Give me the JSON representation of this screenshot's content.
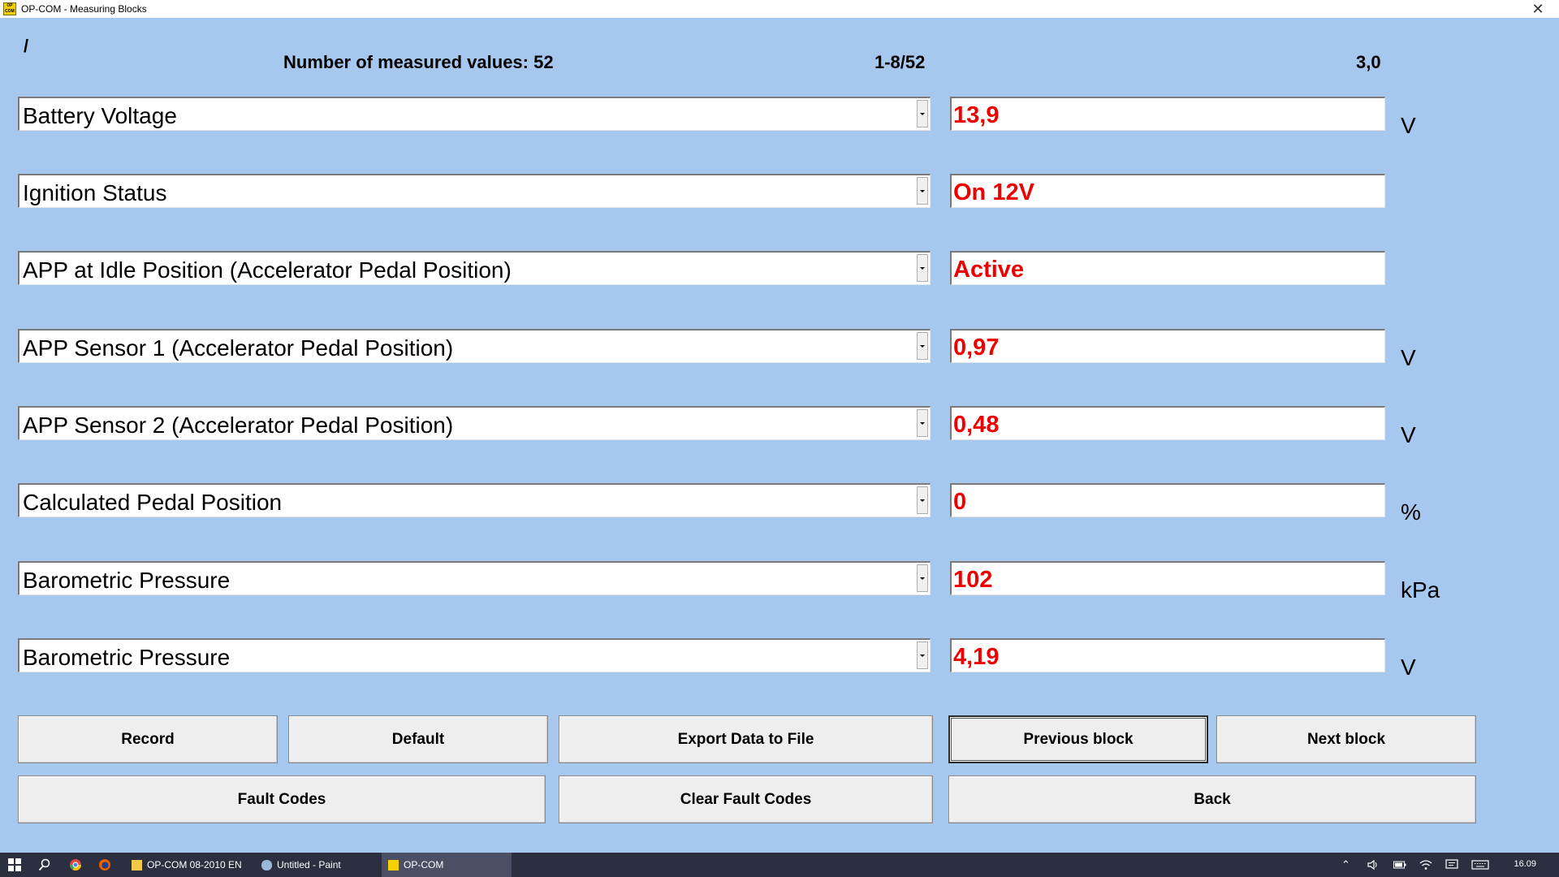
{
  "window": {
    "title": "OP-COM - Measuring Blocks",
    "close_glyph": "✕",
    "logo_line1": "OP",
    "logo_line2": "COM"
  },
  "header": {
    "slash": "/",
    "count_label": "Number of measured values: 52",
    "range_label": "1-8/52",
    "speed_label": "3,0"
  },
  "rows": [
    {
      "name": "Battery Voltage",
      "value": "13,9",
      "unit": "V"
    },
    {
      "name": "Ignition Status",
      "value": "On  12V",
      "unit": ""
    },
    {
      "name": "APP at Idle Position (Accelerator Pedal Position)",
      "value": "Active",
      "unit": ""
    },
    {
      "name": "APP Sensor 1 (Accelerator Pedal Position)",
      "value": "0,97",
      "unit": "V"
    },
    {
      "name": "APP Sensor 2 (Accelerator Pedal Position)",
      "value": "0,48",
      "unit": "V"
    },
    {
      "name": "Calculated Pedal Position",
      "value": "0",
      "unit": "%"
    },
    {
      "name": "Barometric Pressure",
      "value": "102",
      "unit": "kPa"
    },
    {
      "name": "Barometric Pressure",
      "value": "4,19",
      "unit": "V"
    }
  ],
  "buttons": {
    "record": "Record",
    "default": "Default",
    "export": "Export Data to File",
    "previous": "Previous block",
    "next": "Next block",
    "fault_codes": "Fault Codes",
    "clear_fault_codes": "Clear Fault Codes",
    "back": "Back"
  },
  "taskbar": {
    "tasks": [
      "OP-COM 08-2010 EN",
      "Untitled - Paint",
      "OP-COM"
    ],
    "active_task": "OP-COM",
    "clock": "16.09"
  },
  "colors": {
    "background": "#a6c8ee",
    "value_text": "#ee0000",
    "taskbar": "#2b2f3f"
  }
}
